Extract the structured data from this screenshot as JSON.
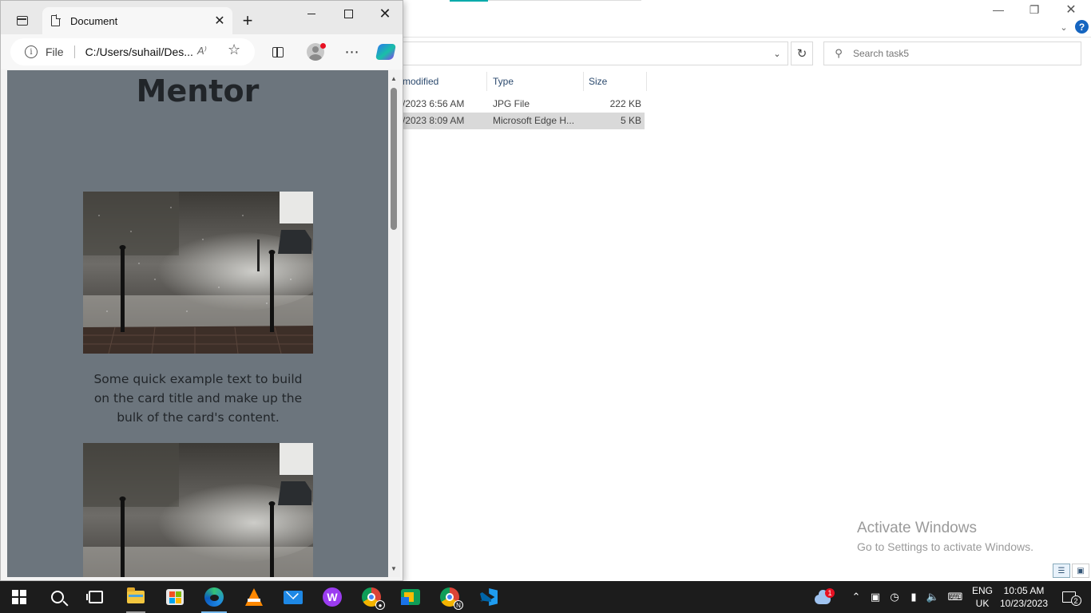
{
  "explorer": {
    "search_placeholder": "Search task5",
    "columns": [
      "modified",
      "Type",
      "Size"
    ],
    "rows": [
      {
        "modified": "/2023 6:56 AM",
        "type": "JPG File",
        "size": "222 KB"
      },
      {
        "modified": "/2023 8:09 AM",
        "type": "Microsoft Edge H...",
        "size": "5 KB"
      }
    ],
    "help": "?",
    "watermark": {
      "line1": "Activate Windows",
      "line2": "Go to Settings to activate Windows."
    }
  },
  "browser": {
    "tab_title": "Document",
    "site_info": "File",
    "url": "C:/Users/suhail/Des...",
    "read_aloud": "A⁾"
  },
  "page": {
    "heading": "Mentor",
    "card_text": "Some quick example text to build on the card title and make up the bulk of the card's content."
  },
  "taskbar": {
    "language": "ENG",
    "region": "UK",
    "time": "10:05 AM",
    "date": "10/23/2023",
    "notification_count": "2",
    "weather_badge": "1",
    "chrome_badge": "N"
  }
}
